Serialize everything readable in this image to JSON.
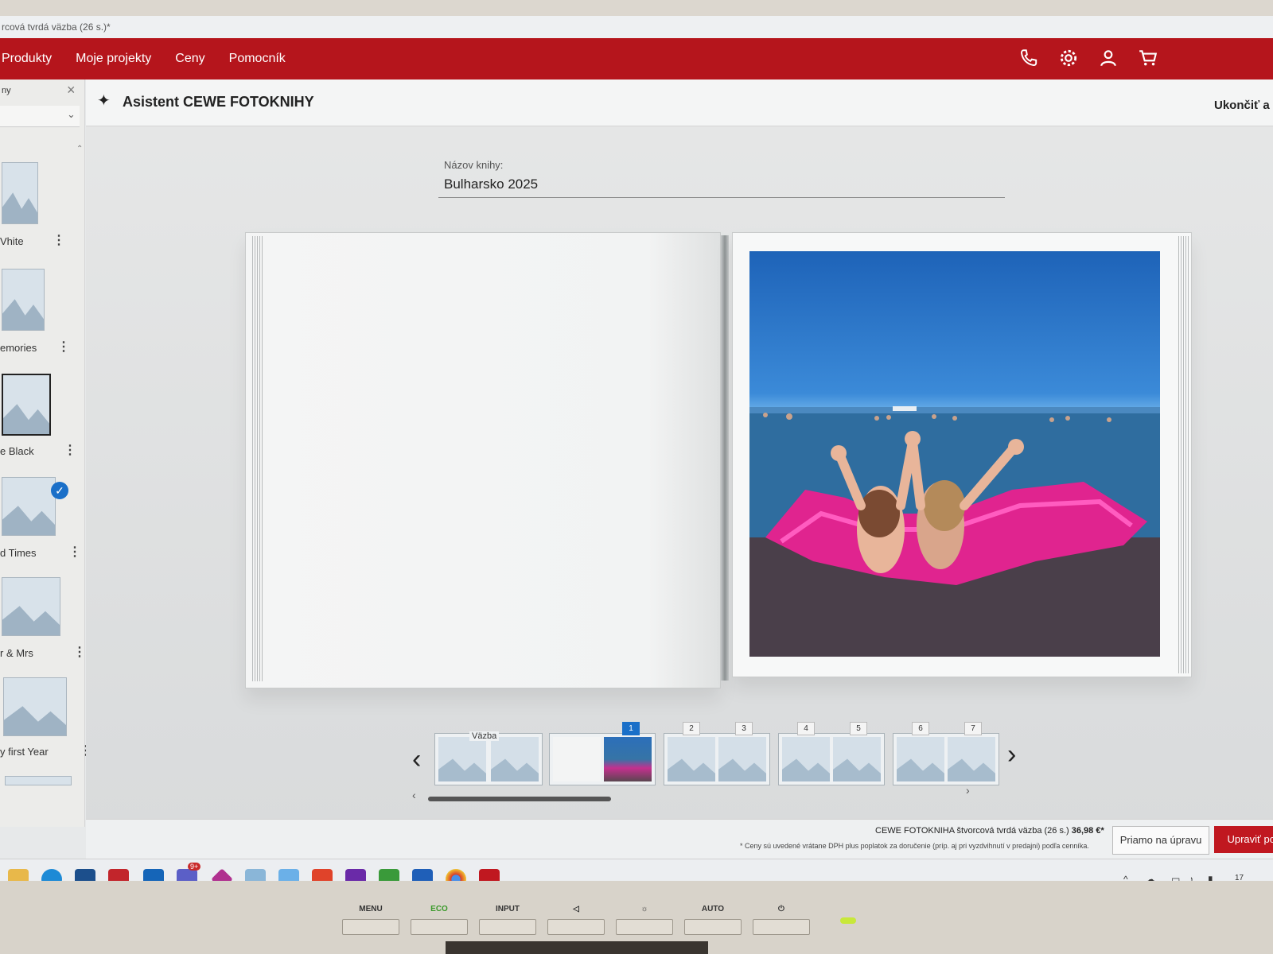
{
  "window": {
    "title": "rcová tvrdá väzba (26 s.)*"
  },
  "menu": {
    "items": [
      "Produkty",
      "Moje projekty",
      "Ceny",
      "Pomocník"
    ],
    "icons": [
      "phone-icon",
      "gear-icon",
      "user-icon",
      "cart-icon"
    ]
  },
  "sidebar": {
    "title": "ny",
    "dropdown_value": "",
    "templates": [
      {
        "label": "Vhite"
      },
      {
        "label": "emories"
      },
      {
        "label": "e Black"
      },
      {
        "label": "d Times",
        "selected": true
      },
      {
        "label": "r & Mrs"
      },
      {
        "label": "y first Year"
      }
    ]
  },
  "assistant": {
    "title": "Asistent CEWE FOTOKNIHY",
    "exit_label": "Ukončiť a"
  },
  "book": {
    "name_label": "Názov knihy:",
    "name_value": "Bulharsko 2025"
  },
  "pager": {
    "cover_label": "Väzba",
    "pages": [
      "1",
      "2",
      "3",
      "4",
      "5",
      "6",
      "7"
    ],
    "active_page": "1"
  },
  "footer": {
    "product": "CEWE FOTOKNIHA štvorcová tvrdá väzba (26 s.)",
    "price": "36,98 €*",
    "note": "* Ceny sú uvedené vrátane DPH plus poplatok za doručenie (príp. aj pri vyzdvihnutí v predajni) podľa cenníka.",
    "direct_button": "Priamo na úpravu",
    "edit_button": "Upraviť poč"
  },
  "taskbar": {
    "badge": "9+",
    "clock": "17"
  },
  "monitor": {
    "buttons": [
      "MENU",
      "ECO",
      "INPUT",
      "◁",
      "☼",
      "AUTO",
      "⏻"
    ]
  },
  "colors": {
    "brand_red": "#b5151c",
    "accent_blue": "#1a6fc8"
  }
}
